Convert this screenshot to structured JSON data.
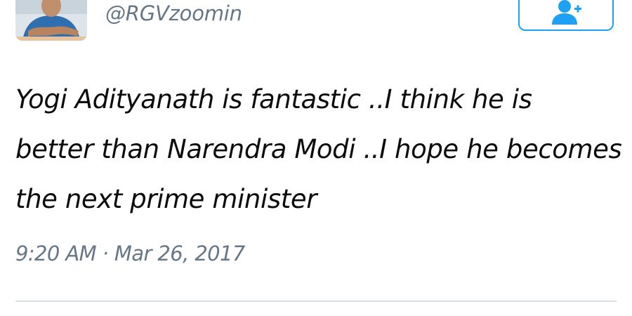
{
  "tweet": {
    "handle": "@RGVzoomin",
    "text_lines": [
      "Yogi Adityanath is fantastic ..I think he is",
      "better than Narendra Modi ..I hope he becomes",
      "the next prime minister"
    ],
    "timestamp": "9:20 AM · Mar 26, 2017"
  },
  "follow_button": {
    "icon": "follow-user-icon"
  },
  "colors": {
    "accent": "#1da1f2",
    "secondary_text": "#657786",
    "divider": "#d8dee3"
  }
}
